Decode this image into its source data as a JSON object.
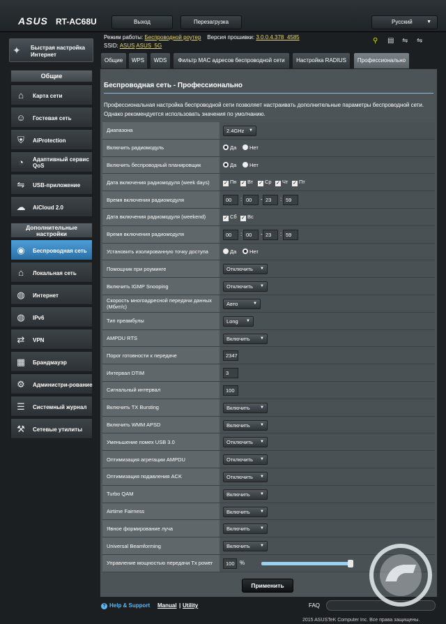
{
  "header": {
    "brand": "ASUS",
    "model": "RT-AC68U",
    "logout_label": "Выход",
    "reboot_label": "Перезагрузка",
    "language": "Русский"
  },
  "info": {
    "mode_label": "Режим работы:",
    "mode_value": "Беспроводной роутер",
    "firmware_label": "Версия прошивки:",
    "firmware_value": "3.0.0.4.378_4585",
    "ssid_label": "SSID:",
    "ssid_1": "ASUS",
    "ssid_2": "ASUS_5G"
  },
  "status_icons": [
    "wifi-icon",
    "printer-icon",
    "usb-icon",
    "usb-icon"
  ],
  "sidebar": {
    "quick_setup": "Быстрая настройка Интернет",
    "general_header": "Общие",
    "general_items": [
      {
        "label": "Карта сети",
        "icon": "network-map-icon"
      },
      {
        "label": "Гостевая сеть",
        "icon": "guest-network-icon"
      },
      {
        "label": "AiProtection",
        "icon": "shield-icon"
      },
      {
        "label": "Адаптивный сервис QoS",
        "icon": "qos-gauge-icon"
      },
      {
        "label": "USB-приложение",
        "icon": "usb-app-icon"
      },
      {
        "label": "AiCloud 2.0",
        "icon": "cloud-icon"
      }
    ],
    "advanced_header": "Дополнительные настройки",
    "advanced_items": [
      {
        "label": "Беспроводная сеть",
        "icon": "wireless-icon",
        "active": true
      },
      {
        "label": "Локальная сеть",
        "icon": "home-icon"
      },
      {
        "label": "Интернет",
        "icon": "globe-icon"
      },
      {
        "label": "IPv6",
        "icon": "ipv6-globe-icon"
      },
      {
        "label": "VPN",
        "icon": "vpn-icon"
      },
      {
        "label": "Брандмауэр",
        "icon": "firewall-icon"
      },
      {
        "label": "Администри-рование",
        "icon": "admin-icon"
      },
      {
        "label": "Системный журнал",
        "icon": "log-icon"
      },
      {
        "label": "Сетевые утилиты",
        "icon": "tools-icon"
      }
    ]
  },
  "tabs": [
    "Общие",
    "WPS",
    "WDS",
    "Фильтр MAC адресов беспроводной сети",
    "Настройка RADIUS",
    "Профессионально"
  ],
  "panel": {
    "title": "Беспроводная сеть - Профессионально",
    "description": "Профессиональная настройка беспроводной сети позволяет настраивать дополнительные параметры беспроводной сети. Однако рекомендуется использовать значения по умолчанию."
  },
  "settings": {
    "band": {
      "label": "Диапазона",
      "value": "2.4GHz"
    },
    "radio_enable": {
      "label": "Включить радиомодуль",
      "yes": "Да",
      "no": "Нет"
    },
    "scheduler": {
      "label": "Включить беспроводный планировщик",
      "yes": "Да",
      "no": "Нет"
    },
    "weekdays": {
      "label": "Дата включения радиомодуля (week days)",
      "days": [
        "Пн",
        "Вт",
        "Ср",
        "Чт",
        "Пт"
      ]
    },
    "weekday_time": {
      "label": "Время включения радиомодуля",
      "h1": "00",
      "m1": "00",
      "h2": "23",
      "m2": "59"
    },
    "weekend": {
      "label": "Дата включения радиомодуля (weekend)",
      "days": [
        "Сб",
        "Вс"
      ]
    },
    "weekend_time": {
      "label": "Время включения радиомодуля",
      "h1": "00",
      "m1": "00",
      "h2": "23",
      "m2": "59"
    },
    "ap_isolation": {
      "label": "Установить изолированную точку доступа",
      "yes": "Да",
      "no": "Нет"
    },
    "roaming": {
      "label": "Помощник при роуминге",
      "value": "Отключить"
    },
    "igmp": {
      "label": "Включить IGMP Snooping",
      "value": "Отключить"
    },
    "multicast": {
      "label": "Скорость многоадресной передачи данных (Мбит/с)",
      "value": "Авто"
    },
    "preamble": {
      "label": "Тип преамбулы",
      "value": "Long"
    },
    "ampdu_rts": {
      "label": "AMPDU RTS",
      "value": "Включить"
    },
    "rts_threshold": {
      "label": "Порог готовности к передаче",
      "value": "2347"
    },
    "dtim": {
      "label": "Интервал DTIM",
      "value": "3"
    },
    "beacon": {
      "label": "Сигнальный интервал",
      "value": "100"
    },
    "tx_bursting": {
      "label": "Включить TX Bursting",
      "value": "Включить"
    },
    "wmm_apsd": {
      "label": "Включить WMM APSD",
      "value": "Включить"
    },
    "usb3_interference": {
      "label": "Уменьшение помех USB 3.0",
      "value": "Отключить"
    },
    "ampdu_aggregation": {
      "label": "Оптимизация агрегации AMPDU",
      "value": "Отключить"
    },
    "ack_suppression": {
      "label": "Оптимизация подавления ACK",
      "value": "Отключить"
    },
    "turbo_qam": {
      "label": "Turbo QAM",
      "value": "Включить"
    },
    "airtime_fairness": {
      "label": "Airtime Fairness",
      "value": "Включить"
    },
    "beamforming": {
      "label": "Явное формирование луча",
      "value": "Включить"
    },
    "universal_beamforming": {
      "label": "Universal Beamforming",
      "value": "Включить"
    },
    "tx_power": {
      "label": "Управление мощностью передачи Tx power",
      "value": "100",
      "unit": "%",
      "level": 1.0
    }
  },
  "apply_label": "Применить",
  "footer": {
    "help": "Help & Support",
    "manual": "Manual",
    "separator": "|",
    "utility": "Utility",
    "faq": "FAQ",
    "copyright": "2015 ASUSTeK Computer Inc. Все права защищены."
  },
  "colors": {
    "accent": "#4e9ed8",
    "link": "#5fb6f2",
    "info_value": "#e7d77a",
    "panel_bg": "#4c5458",
    "body_bg": "#1b1f22"
  }
}
